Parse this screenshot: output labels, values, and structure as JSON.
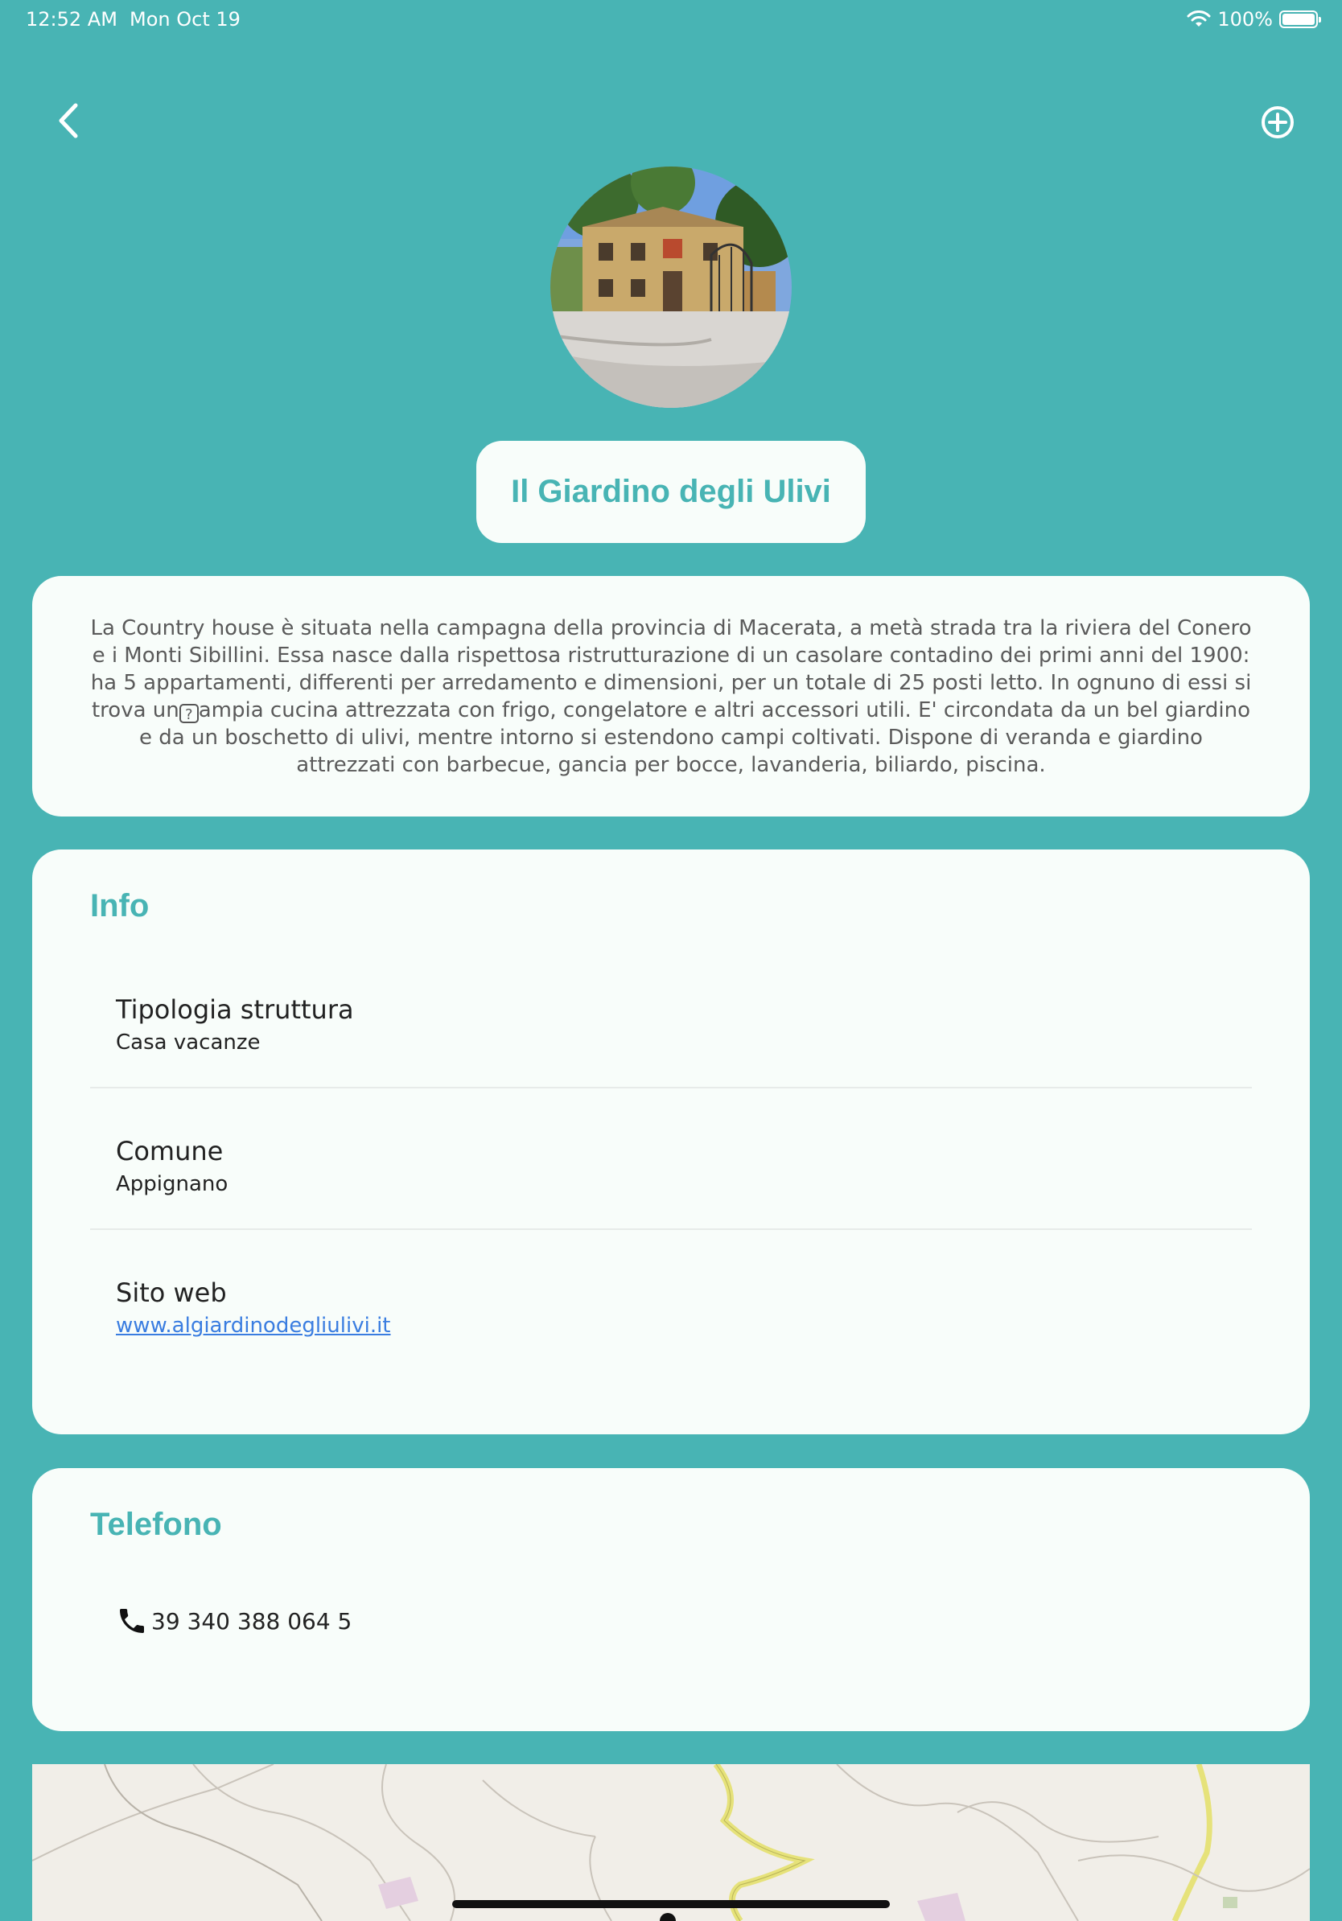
{
  "status_bar": {
    "time": "12:52 AM",
    "date": "Mon Oct 19",
    "battery": "100%"
  },
  "colors": {
    "accent": "#48b4b4",
    "card_bg": "#f8fdfa",
    "link": "#3a7de0"
  },
  "header": {
    "back_icon": "chevron-left-icon",
    "add_icon": "plus-circle-icon"
  },
  "title": "Il Giardino degli Ulivi",
  "description": {
    "part1": "La Country house è situata nella campagna della provincia di Macerata, a metà strada tra la riviera del Conero e i Monti Sibillini. Essa nasce dalla rispettosa ristrutturazione di un casolare contadino dei primi anni del 1900: ha 5 appartamenti, differenti per arredamento e dimensioni, per un totale di 25 posti letto. In ognuno di essi si trova un",
    "glyph": "?",
    "part2": "ampia cucina attrezzata con frigo, congelatore e altri accessori utili. E' circondata da un bel giardino e da un boschetto di ulivi, mentre intorno si estendono campi coltivati. Dispone di veranda e giardino attrezzati con barbecue, gancia per bocce, lavanderia, biliardo, piscina."
  },
  "info": {
    "title": "Info",
    "rows": [
      {
        "label": "Tipologia struttura",
        "value": "Casa vacanze"
      },
      {
        "label": "Comune",
        "value": "Appignano"
      },
      {
        "label": "Sito web",
        "value": "www.algiardinodegliulivi.it"
      }
    ]
  },
  "phone": {
    "title": "Telefono",
    "number": "39 340 388 064 5",
    "icon": "phone-icon"
  }
}
